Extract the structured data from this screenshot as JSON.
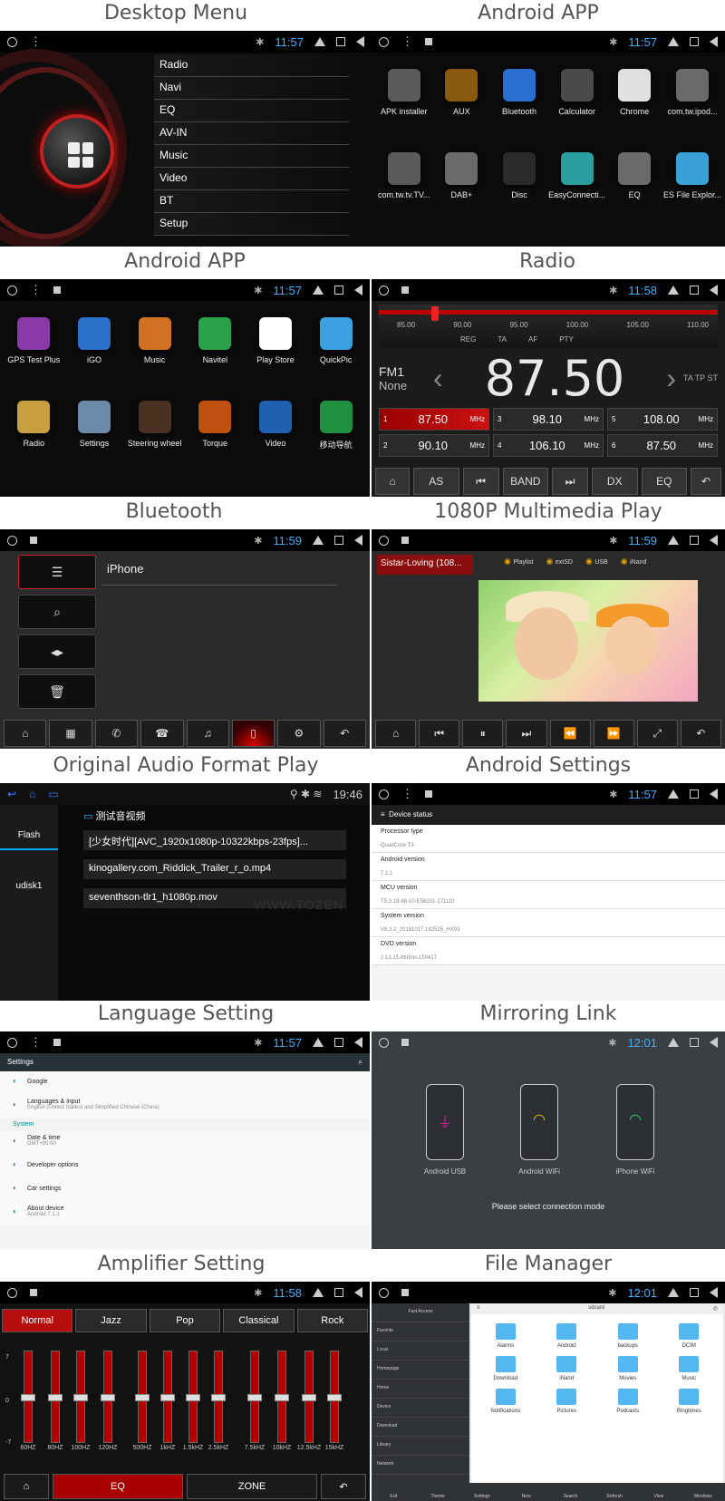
{
  "titles": {
    "desktop": "Desktop Menu",
    "android1": "Android APP",
    "android2": "Android APP",
    "radio": "Radio",
    "bluetooth": "Bluetooth",
    "video": "1080P Multimedia Play",
    "audio": "Original Audio Format Play",
    "settings": "Android Settings",
    "language": "Language Setting",
    "mirror": "Mirroring Link",
    "amplifier": "Amplifier Setting",
    "files": "File Manager"
  },
  "times": {
    "desktop": "11:57",
    "android1": "11:57",
    "android2": "11:57",
    "radio": "11:58",
    "bluetooth": "11:59",
    "video": "11:59",
    "audio": "19:46",
    "settings": "11:57",
    "language": "11:57",
    "mirror": "12:01",
    "amplifier": "11:58",
    "files": "12:01"
  },
  "desktop_menu": [
    "Radio",
    "Navi",
    "EQ",
    "AV-IN",
    "Music",
    "Video",
    "BT",
    "Setup"
  ],
  "apps1": [
    {
      "label": "APK installer",
      "color": "#5a5a5a"
    },
    {
      "label": "AUX",
      "color": "#8a5a10"
    },
    {
      "label": "Bluetooth",
      "color": "#2a6fd0"
    },
    {
      "label": "Calculator",
      "color": "#4a4a4a"
    },
    {
      "label": "Chrome",
      "color": "#e0e0e0"
    },
    {
      "label": "com.tw.ipod...",
      "color": "#6a6a6a"
    },
    {
      "label": "com.tw.tv.TV...",
      "color": "#5a5a5a"
    },
    {
      "label": "DAB+",
      "color": "#6a6a6a"
    },
    {
      "label": "Disc",
      "color": "#2a2a2a"
    },
    {
      "label": "EasyConnecti...",
      "color": "#2a9f9f"
    },
    {
      "label": "EQ",
      "color": "#6a6a6a"
    },
    {
      "label": "ES File Explor...",
      "color": "#3aa0d8"
    }
  ],
  "apps2": [
    {
      "label": "GPS Test Plus",
      "color": "#8a3aa8"
    },
    {
      "label": "iGO",
      "color": "#2a70c8"
    },
    {
      "label": "Music",
      "color": "#d07020"
    },
    {
      "label": "Navitel",
      "color": "#2aa04a"
    },
    {
      "label": "Play Store",
      "color": "#ffffff"
    },
    {
      "label": "QuickPic",
      "color": "#3aa0e0"
    },
    {
      "label": "Radio",
      "color": "#c8a040"
    },
    {
      "label": "Settings",
      "color": "#6a8aa8"
    },
    {
      "label": "Steering wheel",
      "color": "#4a3020"
    },
    {
      "label": "Torque",
      "color": "#c05010"
    },
    {
      "label": "Video",
      "color": "#2060b0"
    },
    {
      "label": "移动导航",
      "color": "#209040"
    }
  ],
  "radio": {
    "scale": [
      "85.00",
      "90.00",
      "95.00",
      "100.00",
      "105.00",
      "110.00"
    ],
    "flags": [
      "REG",
      "TA",
      "AF",
      "PTY"
    ],
    "band": "FM1",
    "mode": "None",
    "freq": "87.50",
    "tp": "TA  TP  ST",
    "unit": "MHz",
    "presets": [
      {
        "n": "1",
        "v": "87.50"
      },
      {
        "n": "3",
        "v": "98.10"
      },
      {
        "n": "5",
        "v": "108.00"
      },
      {
        "n": "2",
        "v": "90.10"
      },
      {
        "n": "4",
        "v": "106.10"
      },
      {
        "n": "6",
        "v": "87.50"
      }
    ],
    "controls": [
      "AS",
      "BAND",
      "DX",
      "EQ"
    ]
  },
  "bluetooth": {
    "device": "iPhone"
  },
  "video": {
    "title": "Sistar-Loving (108...",
    "sources": [
      "Playlist",
      "extSD",
      "USB",
      "iNand"
    ]
  },
  "audio": {
    "side_flash": "Flash",
    "side_usb": "udisk1",
    "folder": "测试音视频",
    "files": [
      "[少女时代][AVC_1920x1080p-10322kbps-23fps]...",
      "kinogallery.com_Riddick_Trailer_r_o.mp4",
      "seventhson-tlr1_h1080p.mov"
    ],
    "watermark": "WWW.TOZEN"
  },
  "settings": {
    "header": "Device status",
    "items": [
      {
        "k": "Processor type",
        "v": "QuadCore-T3"
      },
      {
        "k": "Android version",
        "v": "7.1.1"
      },
      {
        "k": "MCU version",
        "v": "T5.3.19-98-10-E56201-171110"
      },
      {
        "k": "System version",
        "v": "V8.3.2_20181017.192525_HX03"
      },
      {
        "k": "DVD version",
        "v": "2.13.15-860mc-150417"
      }
    ]
  },
  "language": {
    "header": "Settings",
    "google": "Google",
    "lang_title": "Languages & input",
    "lang_sub": "English (United States) and Simplified Chinese (China)",
    "section": "System",
    "date_title": "Date & time",
    "date_sub": "GMT+00:00",
    "dev": "Developer options",
    "car": "Car settings",
    "about": "About device",
    "about_sub": "Android 7.1.1"
  },
  "mirror": {
    "phones": [
      "Android USB",
      "Android WiFi",
      "iPhone WiFi"
    ],
    "message": "Please select connection mode"
  },
  "amplifier": {
    "presets": [
      "Normal",
      "Jazz",
      "Pop",
      "Classical",
      "Rock"
    ],
    "ylabels": [
      "7",
      "0",
      "-7"
    ],
    "bands": [
      "60HZ",
      "80HZ",
      "100HZ",
      "120HZ",
      "500HZ",
      "1kHZ",
      "1.5kHZ",
      "2.5kHZ",
      "7.5kHZ",
      "10kHZ",
      "12.5kHZ",
      "15kHZ"
    ],
    "bottom": [
      "EQ",
      "ZONE"
    ]
  },
  "files": {
    "side": [
      "Favorite",
      "Local",
      "Homepage",
      "Home",
      "Device",
      "Download",
      "Library",
      "Network"
    ],
    "path": "sdcard",
    "folders": [
      "Alarms",
      "Android",
      "backups",
      "DCIM",
      "Download",
      "iNand",
      "Movies",
      "Music",
      "Notifications",
      "Pictures",
      "Podcasts",
      "Ringtones"
    ],
    "bottom": [
      "Exit",
      "Theme",
      "Settings",
      "New",
      "Search",
      "Refresh",
      "View",
      "Windows"
    ],
    "fast": "Fast Access"
  }
}
